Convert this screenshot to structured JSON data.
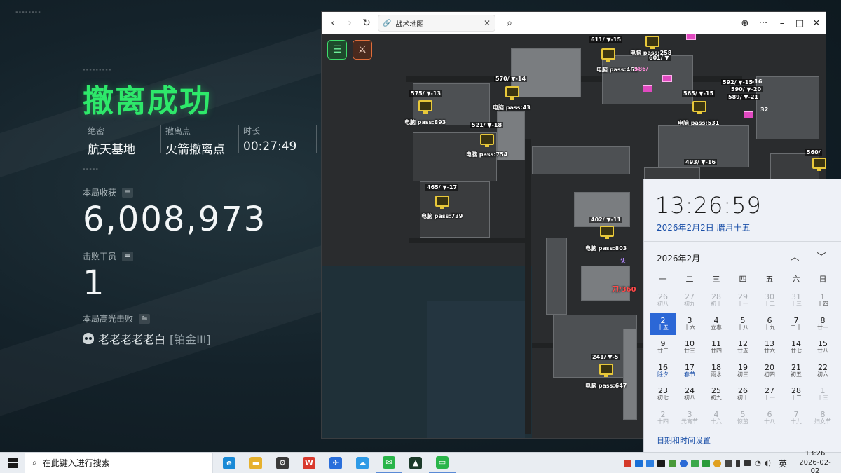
{
  "game": {
    "title": "撤离成功",
    "info": [
      {
        "label": "绝密",
        "value": "航天基地"
      },
      {
        "label": "撤离点",
        "value": "火箭撤离点"
      },
      {
        "label": "时长",
        "value": "00:27:49"
      }
    ],
    "income_label": "本局收获",
    "income_value": "6,008,973",
    "kills_label": "击败干员",
    "kills_value": "1",
    "highlight_label": "本局高光击败",
    "highlight_player": "老老老老老白",
    "highlight_rank": "[铂金III]"
  },
  "browser": {
    "tab_title": "战术地图",
    "nav": {
      "back": "‹",
      "forward": "›",
      "refresh": "↻"
    },
    "controls": {
      "globe": "⊕",
      "more": "···",
      "minimize": "–",
      "maximize": "□",
      "close": "✕"
    },
    "map_buttons": {
      "menu": "☰",
      "weapon": "⚔"
    },
    "map_labels": [
      {
        "id": "611",
        "text": "611/ ▼-15"
      },
      {
        "id": "pass258",
        "text": "电脑 pass:258"
      },
      {
        "id": "601",
        "text": "601/ ▼"
      },
      {
        "id": "pass462",
        "text": "电脑 pass:462"
      },
      {
        "id": "586",
        "text": "586/"
      },
      {
        "id": "570",
        "text": "570/ ▼-14"
      },
      {
        "id": "575",
        "text": "575/ ▼-13"
      },
      {
        "id": "pass43",
        "text": "电脑 pass:43"
      },
      {
        "id": "565",
        "text": "565/ ▼-15"
      },
      {
        "id": "592",
        "text": "592/ ▼-15"
      },
      {
        "id": "590",
        "text": "590/ ▼-20"
      },
      {
        "id": "589",
        "text": "589/ ▼-21"
      },
      {
        "id": "pass893",
        "text": "电脑 pass:893"
      },
      {
        "id": "521",
        "text": "521/ ▼-18"
      },
      {
        "id": "pass531",
        "text": "电脑 pass:531"
      },
      {
        "id": "pass754",
        "text": "电脑 pass:754"
      },
      {
        "id": "493",
        "text": "493/ ▼-16"
      },
      {
        "id": "560",
        "text": "560/"
      },
      {
        "id": "465",
        "text": "465/ ▼-17"
      },
      {
        "id": "pass739",
        "text": "电脑 pass:739"
      },
      {
        "id": "402",
        "text": "402/ ▼-11"
      },
      {
        "id": "pass803",
        "text": "电脑 pass:803"
      },
      {
        "id": "head",
        "text": "头"
      },
      {
        "id": "red360",
        "text": "刀/360"
      },
      {
        "id": "241",
        "text": "241/ ▼-5"
      },
      {
        "id": "pass647",
        "text": "电脑 pass:647"
      },
      {
        "id": "minus16",
        "text": "-16"
      },
      {
        "id": "minus32",
        "text": "32"
      }
    ]
  },
  "calendar": {
    "time": "13:26:59",
    "date_long": "2026年2月2日 腊月十五",
    "month_title": "2026年2月",
    "weekdays": [
      "一",
      "二",
      "三",
      "四",
      "五",
      "六",
      "日"
    ],
    "days": [
      {
        "n": "26",
        "l": "初八",
        "out": true
      },
      {
        "n": "27",
        "l": "初九",
        "out": true
      },
      {
        "n": "28",
        "l": "初十",
        "out": true
      },
      {
        "n": "29",
        "l": "十一",
        "out": true
      },
      {
        "n": "30",
        "l": "十二",
        "out": true
      },
      {
        "n": "31",
        "l": "十三",
        "out": true
      },
      {
        "n": "1",
        "l": "十四"
      },
      {
        "n": "2",
        "l": "十五",
        "today": true
      },
      {
        "n": "3",
        "l": "十六"
      },
      {
        "n": "4",
        "l": "立春"
      },
      {
        "n": "5",
        "l": "十八"
      },
      {
        "n": "6",
        "l": "十九"
      },
      {
        "n": "7",
        "l": "二十"
      },
      {
        "n": "8",
        "l": "廿一"
      },
      {
        "n": "9",
        "l": "廿二"
      },
      {
        "n": "10",
        "l": "廿三"
      },
      {
        "n": "11",
        "l": "廿四"
      },
      {
        "n": "12",
        "l": "廿五"
      },
      {
        "n": "13",
        "l": "廿六"
      },
      {
        "n": "14",
        "l": "廿七"
      },
      {
        "n": "15",
        "l": "廿八"
      },
      {
        "n": "16",
        "l": "除夕",
        "holiday": true
      },
      {
        "n": "17",
        "l": "春节",
        "holiday": true
      },
      {
        "n": "18",
        "l": "雨水"
      },
      {
        "n": "19",
        "l": "初三"
      },
      {
        "n": "20",
        "l": "初四"
      },
      {
        "n": "21",
        "l": "初五"
      },
      {
        "n": "22",
        "l": "初六"
      },
      {
        "n": "23",
        "l": "初七"
      },
      {
        "n": "24",
        "l": "初八"
      },
      {
        "n": "25",
        "l": "初九"
      },
      {
        "n": "26",
        "l": "初十"
      },
      {
        "n": "27",
        "l": "十一"
      },
      {
        "n": "28",
        "l": "十二"
      },
      {
        "n": "1",
        "l": "十三",
        "out": true
      },
      {
        "n": "2",
        "l": "十四",
        "out": true
      },
      {
        "n": "3",
        "l": "元宵节",
        "out": true
      },
      {
        "n": "4",
        "l": "十六",
        "out": true
      },
      {
        "n": "5",
        "l": "惊蛰",
        "out": true
      },
      {
        "n": "6",
        "l": "十八",
        "out": true
      },
      {
        "n": "7",
        "l": "十九",
        "out": true
      },
      {
        "n": "8",
        "l": "妇女节",
        "out": true
      }
    ],
    "footer": "日期和时间设置"
  },
  "taskbar": {
    "search_placeholder": "在此键入进行搜索",
    "ime": "英",
    "clock_time": "13:26",
    "clock_date": "2026-02-02",
    "apps": [
      {
        "name": "edge",
        "glyph": "e",
        "color": "#1a8ad6"
      },
      {
        "name": "file-explorer",
        "glyph": "▬",
        "color": "#e6b12e"
      },
      {
        "name": "settings",
        "glyph": "⚙",
        "color": "#3a3a3a"
      },
      {
        "name": "wps",
        "glyph": "W",
        "color": "#d93a2e"
      },
      {
        "name": "feishu",
        "glyph": "✈",
        "color": "#2a6fdb"
      },
      {
        "name": "baidu-netdisk",
        "glyph": "☁",
        "color": "#2e9ae6"
      },
      {
        "name": "wechat",
        "glyph": "✉",
        "color": "#2ab54a"
      },
      {
        "name": "game-launcher",
        "glyph": "▲",
        "color": "#1c3a2a"
      },
      {
        "name": "chat-app",
        "glyph": "▭",
        "color": "#2ab54a"
      }
    ]
  }
}
